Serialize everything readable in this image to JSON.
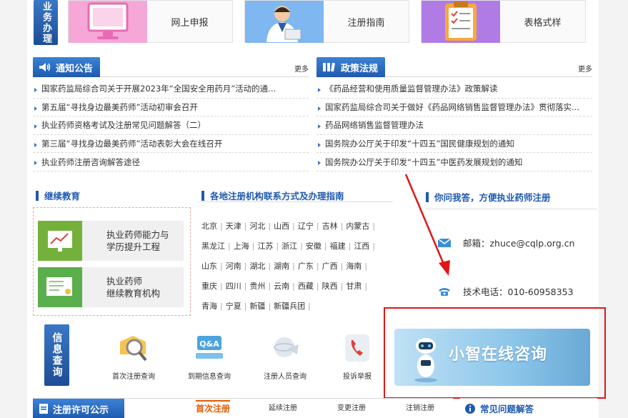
{
  "business": {
    "side_label": "业务办理",
    "tiles": [
      {
        "label": "网上申报",
        "icon": "monitor-icon"
      },
      {
        "label": "注册指南",
        "icon": "consultant-icon"
      },
      {
        "label": "表格式样",
        "icon": "clipboard-icon"
      }
    ]
  },
  "notice": {
    "title": "通知公告",
    "more": "更多",
    "items": [
      "国家药监局综合司关于开展2023年“全国安全用药月”活动的通...",
      "第五届“寻找身边最美药师”活动初审会召开",
      "执业药师资格考试及注册常见问题解答（二）",
      "第三届“寻找身边最美药师”活动表彰大会在线召开",
      "执业药师注册咨询解答途径"
    ]
  },
  "policy": {
    "title": "政策法规",
    "more": "更多",
    "items": [
      "《药品经营和使用质量监督管理办法》政策解读",
      "国家药监局综合司关于做好《药品网络销售监督管理办法》贯彻落实...",
      "药品网络销售监督管理办法",
      "国务院办公厅关于印发“十四五”国民健康规划的通知",
      "国务院办公厅关于印发“十四五”中医药发展规划的通知"
    ]
  },
  "education": {
    "title": "继续教育",
    "items": [
      {
        "line1": "执业药师能力与",
        "line2": "学历提升工程",
        "icon": "chart-icon"
      },
      {
        "line1": "执业药师",
        "line2": "继续教育机构",
        "icon": "certificate-icon"
      }
    ]
  },
  "regions": {
    "title": "各地注册机构联系方式及办理指南",
    "rows": [
      [
        "北京",
        "天津",
        "河北",
        "山西",
        "辽宁",
        "吉林",
        "内蒙古"
      ],
      [
        "黑龙江",
        "上海",
        "江苏",
        "浙江",
        "安徽",
        "福建",
        "江西"
      ],
      [
        "山东",
        "河南",
        "湖北",
        "湖南",
        "广东",
        "广西",
        "海南"
      ],
      [
        "重庆",
        "四川",
        "贵州",
        "云南",
        "西藏",
        "陕西",
        "甘肃"
      ],
      [
        "青海",
        "宁夏",
        "新疆",
        "新疆兵团"
      ]
    ]
  },
  "ask": {
    "title": "你问我答，方便执业药师注册",
    "email": "邮箱：zhuce@cqlp.org.cn",
    "phone": "技术电话：010-60958353"
  },
  "info_query": {
    "side_label": "信息查询",
    "items": [
      {
        "label": "首次注册查询",
        "icon": "magnifier-icon"
      },
      {
        "label": "到期信息查询",
        "icon": "qa-icon"
      },
      {
        "label": "注册人员查询",
        "icon": "globe-icon"
      },
      {
        "label": "投诉举报",
        "icon": "phone-icon"
      }
    ],
    "consult_label": "小智在线咨询"
  },
  "license": {
    "title": "注册许可公示",
    "tabs": [
      "首次注册",
      "延续注册",
      "变更注册",
      "注销注册"
    ],
    "active_tab": "首次注册"
  },
  "faq": {
    "title": "常见问题解答"
  },
  "colors": {
    "primary_blue": "#1f5ab0",
    "annotation_red": "#e01515",
    "active_orange": "#e05a00"
  }
}
